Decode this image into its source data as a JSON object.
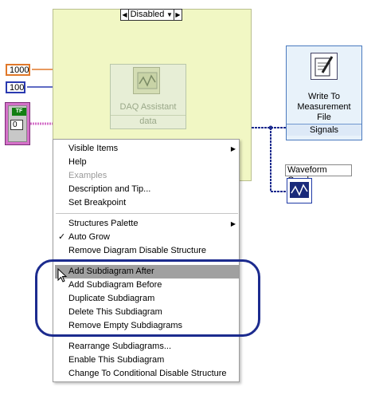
{
  "structure": {
    "selector_value": "Disabled"
  },
  "constants": {
    "samples": "1000",
    "rate": "100",
    "cluster_bool": "TF",
    "cluster_num": "0"
  },
  "daq_assistant": {
    "title": "DAQ Assistant",
    "terminal": "data"
  },
  "write_file": {
    "title_line1": "Write To",
    "title_line2": "Measurement",
    "title_line3": "File",
    "terminal": "Signals"
  },
  "waveform_graph": {
    "label": "Waveform Graph"
  },
  "menu": {
    "group1": [
      {
        "label": "Visible Items",
        "submenu": true
      },
      {
        "label": "Help"
      },
      {
        "label": "Examples",
        "disabled": true
      },
      {
        "label": "Description and Tip..."
      },
      {
        "label": "Set Breakpoint"
      }
    ],
    "group2": [
      {
        "label": "Structures Palette",
        "submenu": true
      },
      {
        "label": "Auto Grow",
        "checked": true
      },
      {
        "label": "Remove Diagram Disable Structure"
      }
    ],
    "group3": [
      {
        "label": "Add Subdiagram After",
        "highlighted": true
      },
      {
        "label": "Add Subdiagram Before"
      },
      {
        "label": "Duplicate Subdiagram"
      },
      {
        "label": "Delete This Subdiagram"
      },
      {
        "label": "Remove Empty Subdiagrams"
      }
    ],
    "group4": [
      {
        "label": "Rearrange Subdiagrams..."
      },
      {
        "label": "Enable This Subdiagram"
      },
      {
        "label": "Change To Conditional Disable Structure"
      }
    ]
  },
  "colors": {
    "structure_bg": "#f1f7c4",
    "callout": "#1c2b8e",
    "highlight": "#a0a0a0",
    "orange_wire": "#e0782a",
    "blue_wire": "#2a3ab0",
    "pink_wire": "#d470c8"
  }
}
